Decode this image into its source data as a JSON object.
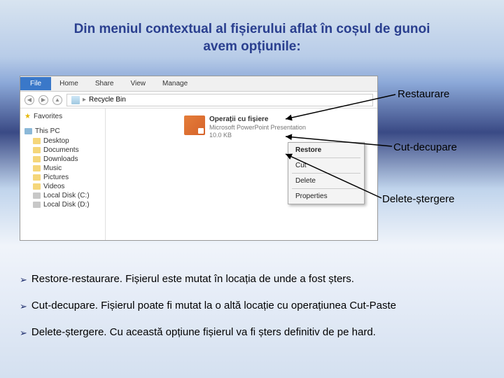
{
  "title_line1": "Din meniul contextual al fișierului aflat în coșul de gunoi",
  "title_line2": "avem opțiunile:",
  "ribbon": {
    "file": "File",
    "home": "Home",
    "share": "Share",
    "view": "View",
    "manage": "Manage"
  },
  "address_label": "Recycle Bin",
  "sidebar": {
    "favorites": "Favorites",
    "this_pc": "This PC",
    "items": [
      "Desktop",
      "Documents",
      "Downloads",
      "Music",
      "Pictures",
      "Videos",
      "Local Disk (C:)",
      "Local Disk (D:)"
    ]
  },
  "file": {
    "name": "Operații cu fișiere",
    "type": "Microsoft PowerPoint Presentation",
    "size": "10.0 KB"
  },
  "menu": {
    "restore": "Restore",
    "cut": "Cut",
    "delete": "Delete",
    "properties": "Properties"
  },
  "callouts": {
    "restore": "Restaurare",
    "cut": "Cut-decupare",
    "delete": "Delete-ștergere"
  },
  "bullets": {
    "b1": "Restore-restaurare. Fișierul este mutat în locația de unde a fost șters.",
    "b2": "Cut-decupare. Fișierul poate fi mutat la o altă locație cu operațiunea Cut-Paste",
    "b3": "Delete-ștergere. Cu această opțiune fișierul va fi șters definitiv de pe hard."
  }
}
